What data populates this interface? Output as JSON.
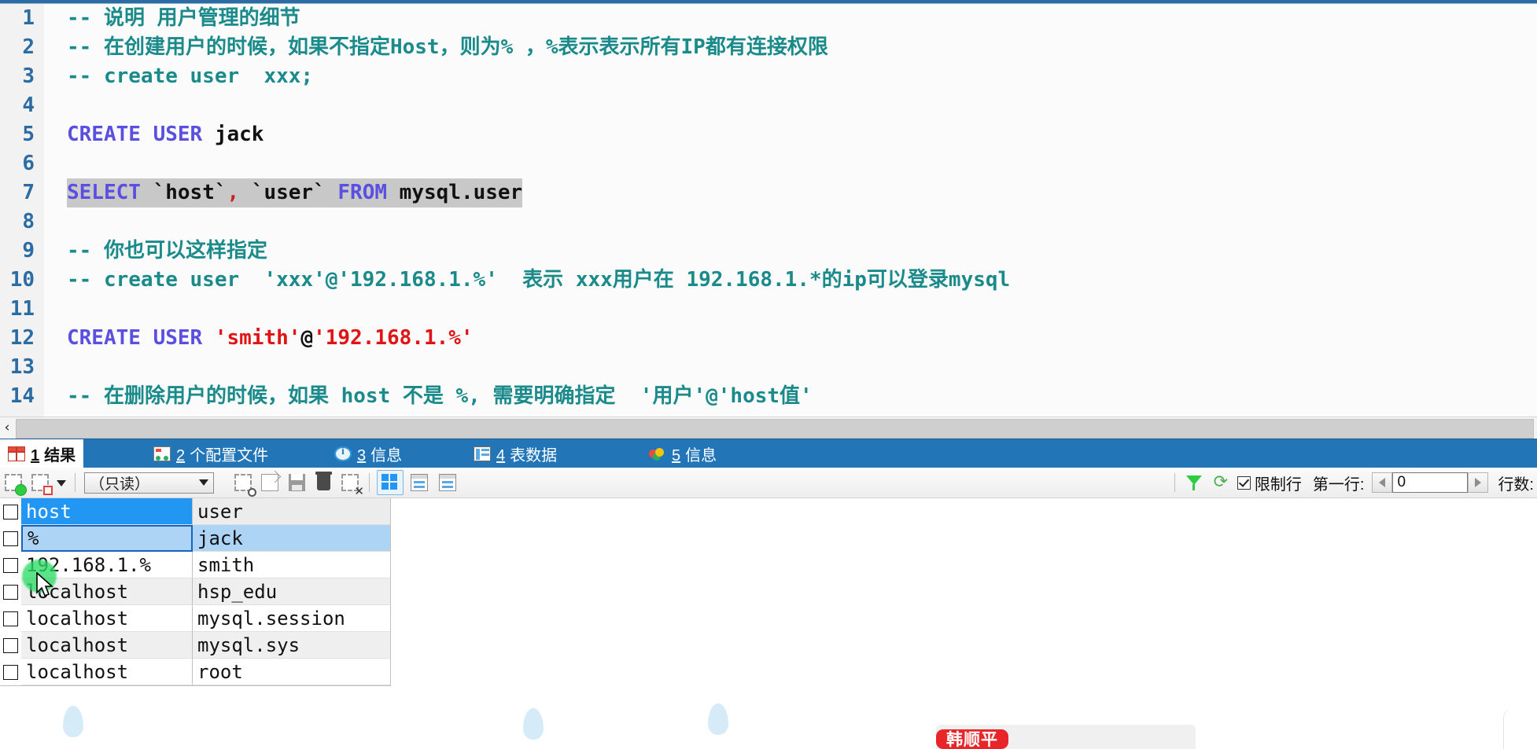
{
  "editor": {
    "lines": [
      {
        "n": "1",
        "segments": [
          {
            "t": "-- 说明 用户管理的细节",
            "c": "cm"
          }
        ]
      },
      {
        "n": "2",
        "segments": [
          {
            "t": "-- 在创建用户的时候，如果不指定Host，则为% ，%表示表示所有IP都有连接权限",
            "c": "cm"
          }
        ]
      },
      {
        "n": "3",
        "segments": [
          {
            "t": "-- create user  xxx;",
            "c": "cm"
          }
        ]
      },
      {
        "n": "4",
        "segments": []
      },
      {
        "n": "5",
        "segments": [
          {
            "t": "CREATE USER ",
            "c": "kw"
          },
          {
            "t": "jack",
            "c": "id"
          }
        ]
      },
      {
        "n": "6",
        "segments": []
      },
      {
        "n": "7",
        "selected": true,
        "segments": [
          {
            "t": "SELECT ",
            "c": "kw"
          },
          {
            "t": "`host`",
            "c": "id"
          },
          {
            "t": ",",
            "c": "punct"
          },
          {
            "t": " `user` ",
            "c": "id"
          },
          {
            "t": "FROM ",
            "c": "kw"
          },
          {
            "t": "mysql.user",
            "c": "id"
          }
        ]
      },
      {
        "n": "8",
        "segments": []
      },
      {
        "n": "9",
        "segments": [
          {
            "t": "-- 你也可以这样指定",
            "c": "cm"
          }
        ]
      },
      {
        "n": "10",
        "segments": [
          {
            "t": "-- create user  'xxx'@'192.168.1.%'  表示 xxx用户在 192.168.1.*的ip可以登录mysql",
            "c": "cm"
          }
        ]
      },
      {
        "n": "11",
        "segments": []
      },
      {
        "n": "12",
        "segments": [
          {
            "t": "CREATE USER ",
            "c": "kw"
          },
          {
            "t": "'smith'",
            "c": "str"
          },
          {
            "t": "@",
            "c": "id"
          },
          {
            "t": "'192.168.1.%'",
            "c": "str"
          }
        ]
      },
      {
        "n": "13",
        "segments": []
      },
      {
        "n": "14",
        "segments": [
          {
            "t": "-- 在删除用户的时候，如果 host 不是 %, 需要明确指定  '用户'@'host值'",
            "c": "cm"
          }
        ]
      }
    ]
  },
  "scrollbar": {
    "left_arrow": "‹"
  },
  "tabs": [
    {
      "key": "1",
      "label": "结果",
      "icon": "grid-red-icon",
      "active": true
    },
    {
      "key": "2",
      "label": "个配置文件",
      "icon": "profile-icon",
      "active": false
    },
    {
      "key": "3",
      "label": "信息",
      "icon": "info-circle-icon",
      "active": false
    },
    {
      "key": "4",
      "label": "表数据",
      "icon": "table-grid-icon",
      "active": false
    },
    {
      "key": "5",
      "label": "信息",
      "icon": "color-balls-icon",
      "active": false
    }
  ],
  "toolbar": {
    "mode_value": "（只读）",
    "limit_rows_label": "限制行",
    "limit_rows_checked": true,
    "first_row_label": "第一行:",
    "first_row_value": "0",
    "row_count_label": "行数:",
    "refresh_glyph": "⟳"
  },
  "grid": {
    "columns": [
      "host",
      "user"
    ],
    "selected_column": "host",
    "rows": [
      {
        "host": "%",
        "user": "jack",
        "selected": true
      },
      {
        "host": "192.168.1.%",
        "user": "smith",
        "selected": false
      },
      {
        "host": "localhost",
        "user": "hsp_edu",
        "selected": false
      },
      {
        "host": "localhost",
        "user": "mysql.session",
        "selected": false
      },
      {
        "host": "localhost",
        "user": "mysql.sys",
        "selected": false
      },
      {
        "host": "localhost",
        "user": "root",
        "selected": false
      }
    ]
  },
  "overlay": {
    "badge_text": "韩顺平"
  },
  "colors": {
    "accent_blue": "#2276b8",
    "comment_teal": "#1a8a8a",
    "keyword": "#5a4fe0",
    "string_red": "#e01414",
    "selection_blue": "#2196f3",
    "click_green": "#2ddc66"
  }
}
